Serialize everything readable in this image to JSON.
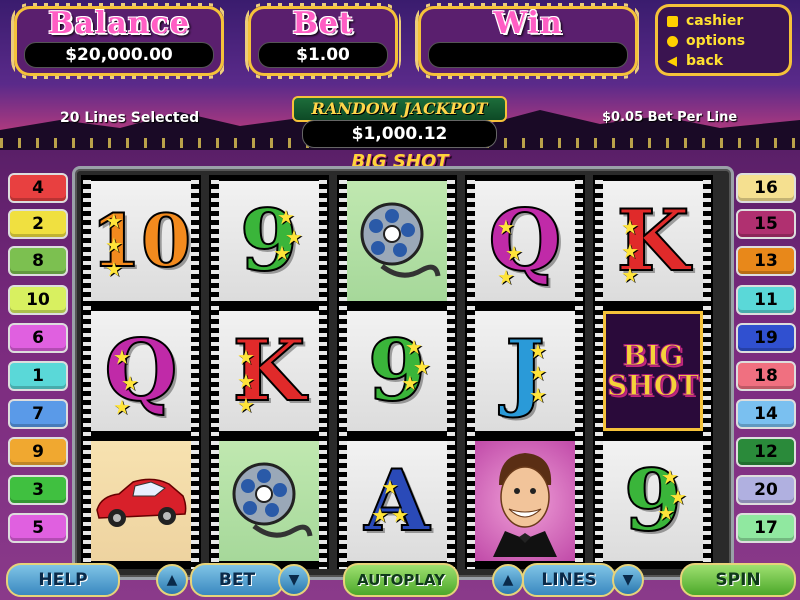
{
  "header": {
    "balance": {
      "title": "Balance",
      "value": "$20,000.00"
    },
    "bet": {
      "title": "Bet",
      "value": "$1.00"
    },
    "win": {
      "title": "Win",
      "value": ""
    }
  },
  "menu": {
    "cashier": "cashier",
    "options": "options",
    "back": "back"
  },
  "info": {
    "lines_selected": "20 Lines Selected",
    "bet_per_line": "$0.05 Bet Per Line"
  },
  "jackpot": {
    "title": "RANDOM JACKPOT",
    "value": "$1,000.12"
  },
  "logo": "BIG SHOT",
  "reels": [
    [
      "10",
      "Q",
      "car"
    ],
    [
      "9",
      "K",
      "film-reel"
    ],
    [
      "film-reel",
      "9",
      "A"
    ],
    [
      "Q",
      "J",
      "big-shot-man"
    ],
    [
      "K",
      "BIG SHOT",
      "9"
    ]
  ],
  "left_lines": [
    {
      "n": "4",
      "color": "#e84040"
    },
    {
      "n": "2",
      "color": "#f0e040"
    },
    {
      "n": "8",
      "color": "#7cc050"
    },
    {
      "n": "10",
      "color": "#d8f060"
    },
    {
      "n": "6",
      "color": "#e060e0"
    },
    {
      "n": "1",
      "color": "#5ad8d8"
    },
    {
      "n": "7",
      "color": "#5a9ae8"
    },
    {
      "n": "9",
      "color": "#f0a830"
    },
    {
      "n": "3",
      "color": "#40c040"
    },
    {
      "n": "5",
      "color": "#e060e0"
    }
  ],
  "right_lines": [
    {
      "n": "16",
      "color": "#f5e090"
    },
    {
      "n": "15",
      "color": "#b03070"
    },
    {
      "n": "13",
      "color": "#e8881a"
    },
    {
      "n": "11",
      "color": "#5ad8d8"
    },
    {
      "n": "19",
      "color": "#3050d0"
    },
    {
      "n": "18",
      "color": "#f07080"
    },
    {
      "n": "14",
      "color": "#7ac0f0"
    },
    {
      "n": "12",
      "color": "#2a8a3a"
    },
    {
      "n": "20",
      "color": "#b0b0e0"
    },
    {
      "n": "17",
      "color": "#90e8a0"
    }
  ],
  "buttons": {
    "help": "HELP",
    "bet": "BET",
    "autoplay": "AUTOPLAY",
    "lines": "LINES",
    "spin": "SPIN"
  }
}
